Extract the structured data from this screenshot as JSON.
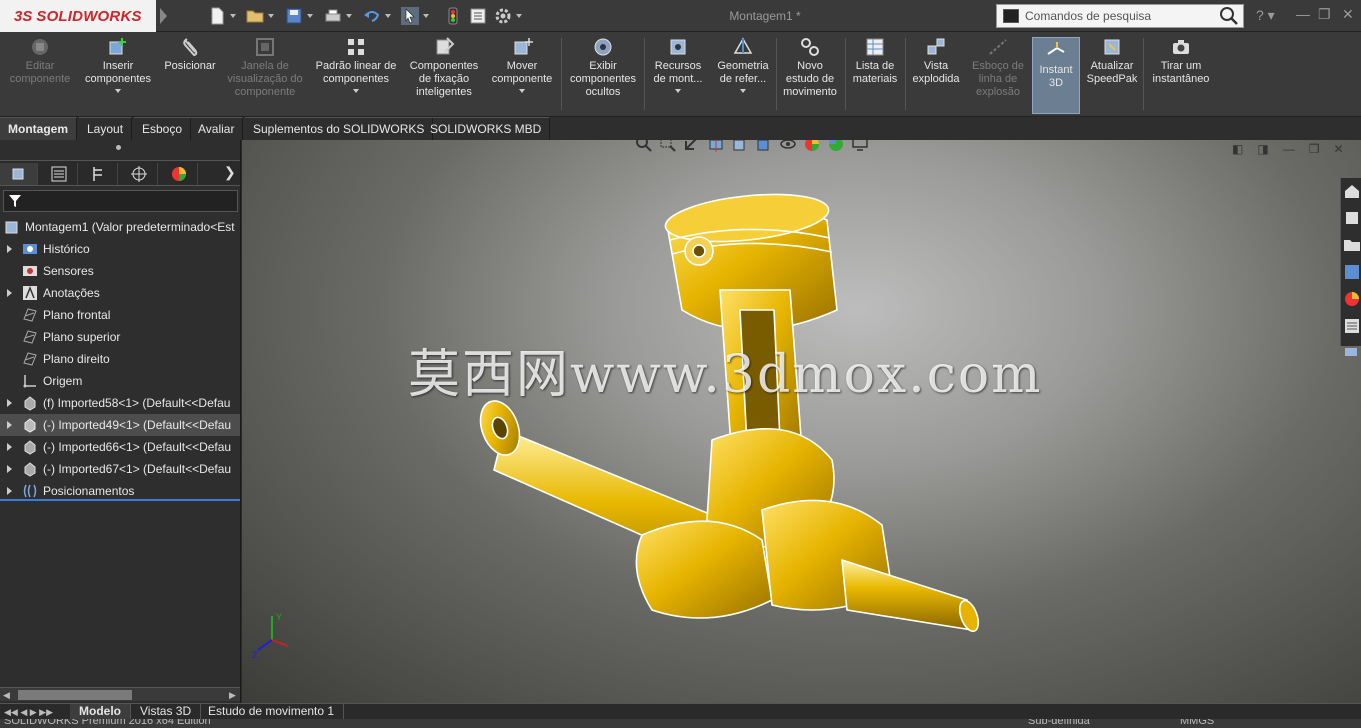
{
  "app": {
    "logo_prefix": "3S",
    "logo_name": "SOLIDWORKS",
    "document_title": "Montagem1 *",
    "search_placeholder": "Comandos de pesquisa",
    "help_label": "?"
  },
  "commands": [
    {
      "id": "editar",
      "label": "Editar componente",
      "enabled": false
    },
    {
      "id": "inserir",
      "label": "Inserir componentes",
      "enabled": true,
      "dropdown": true
    },
    {
      "id": "posicionar",
      "label": "Posicionar",
      "enabled": true
    },
    {
      "id": "janela",
      "label": "Janela de visualização do componente",
      "enabled": false
    },
    {
      "id": "padrao",
      "label": "Padrão linear de componentes",
      "enabled": true,
      "dropdown": true
    },
    {
      "id": "fixacao",
      "label": "Componentes de fixação inteligentes",
      "enabled": true
    },
    {
      "id": "mover",
      "label": "Mover componente",
      "enabled": true,
      "dropdown": true
    },
    {
      "id": "exibir",
      "label": "Exibir componentes ocultos",
      "enabled": true
    },
    {
      "id": "recursos",
      "label": "Recursos de mont...",
      "enabled": true,
      "dropdown": true
    },
    {
      "id": "geometria",
      "label": "Geometria de refer...",
      "enabled": true,
      "dropdown": true
    },
    {
      "id": "novo-estudo",
      "label": "Novo estudo de movimento",
      "enabled": true
    },
    {
      "id": "lista",
      "label": "Lista de materiais",
      "enabled": true
    },
    {
      "id": "vista-explodida",
      "label": "Vista explodida",
      "enabled": true
    },
    {
      "id": "esboco-explosao",
      "label": "Esboço de linha de explosão",
      "enabled": false
    },
    {
      "id": "instant3d",
      "label": "Instant 3D",
      "enabled": true,
      "active": true
    },
    {
      "id": "speedpak",
      "label": "Atualizar SpeedPak",
      "enabled": true
    },
    {
      "id": "instantaneo",
      "label": "Tirar um instantâneo",
      "enabled": true
    }
  ],
  "tabs": [
    "Montagem",
    "Layout",
    "Esboço",
    "Avaliar",
    "Suplementos do SOLIDWORKS",
    "SOLIDWORKS MBD"
  ],
  "active_tab": "Montagem",
  "tree": {
    "root": "Montagem1  (Valor predeterminado<Est",
    "items": [
      {
        "label": "Histórico",
        "expandable": true,
        "icon": "history-icon"
      },
      {
        "label": "Sensores",
        "expandable": false,
        "icon": "sensor-icon"
      },
      {
        "label": "Anotações",
        "expandable": true,
        "icon": "annotation-icon"
      },
      {
        "label": "Plano frontal",
        "expandable": false,
        "icon": "plane-icon"
      },
      {
        "label": "Plano superior",
        "expandable": false,
        "icon": "plane-icon"
      },
      {
        "label": "Plano direito",
        "expandable": false,
        "icon": "plane-icon"
      },
      {
        "label": "Origem",
        "expandable": false,
        "icon": "origin-icon"
      },
      {
        "label": "(f) Imported58<1> (Default<<Defau",
        "expandable": true,
        "icon": "part-icon"
      },
      {
        "label": "(-) Imported49<1> (Default<<Defau",
        "expandable": true,
        "icon": "part-icon",
        "selected": true
      },
      {
        "label": "(-) Imported66<1> (Default<<Defau",
        "expandable": true,
        "icon": "part-icon"
      },
      {
        "label": "(-) Imported67<1> (Default<<Defau",
        "expandable": true,
        "icon": "part-icon"
      },
      {
        "label": "Posicionamentos",
        "expandable": true,
        "icon": "mates-icon"
      }
    ]
  },
  "watermark": "莫西网www.3dmox.com",
  "bottom_tabs": [
    "Modelo",
    "Vistas 3D",
    "Estudo de movimento 1"
  ],
  "active_bottom_tab": "Modelo",
  "status": {
    "left": "SOLIDWORKS Premium 2016 x64 Edition",
    "middle": "Sub-definida",
    "right": "MMGS"
  },
  "triad": {
    "y_label": "Y",
    "z_label": "Z"
  },
  "colors": {
    "part": "#e6b800",
    "accent": "#3a7bd5",
    "logo_red": "#d2232a"
  }
}
